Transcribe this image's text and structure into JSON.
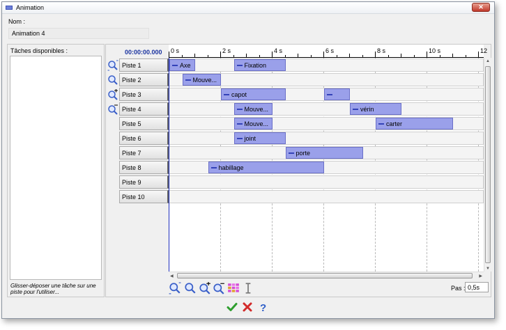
{
  "window": {
    "title": "Animation",
    "close_symbol": "✕"
  },
  "name_field": {
    "label": "Nom :",
    "value": "Animation 4"
  },
  "tasks": {
    "label": "Tâches disponibles :",
    "hint": "Glisser-déposer une tâche sur une piste pour l'utiliser..."
  },
  "timeline": {
    "time_readout": "00:00:00.000",
    "ruler_labels": [
      "0 s",
      "2 s",
      "4 s",
      "6 s",
      "8 s",
      "10 s",
      "12"
    ],
    "tracks": [
      {
        "label": "Piste 1",
        "segments": [
          {
            "text": "Axe",
            "start": 0,
            "end": 1
          },
          {
            "text": "Fixation",
            "start": 2.5,
            "end": 4.5
          }
        ]
      },
      {
        "label": "Piste 2",
        "segments": [
          {
            "text": "Mouve...",
            "start": 0.5,
            "end": 2
          }
        ]
      },
      {
        "label": "Piste 3",
        "segments": [
          {
            "text": "capot",
            "start": 2,
            "end": 4.5
          },
          {
            "text": "",
            "start": 6,
            "end": 7
          }
        ]
      },
      {
        "label": "Piste 4",
        "segments": [
          {
            "text": "Mouve...",
            "start": 2.5,
            "end": 4
          },
          {
            "text": "vérin",
            "start": 7,
            "end": 9
          }
        ]
      },
      {
        "label": "Piste 5",
        "segments": [
          {
            "text": "Mouve...",
            "start": 2.5,
            "end": 4
          },
          {
            "text": "carter",
            "start": 8,
            "end": 11
          }
        ]
      },
      {
        "label": "Piste 6",
        "segments": [
          {
            "text": "joint",
            "start": 2.5,
            "end": 4.5
          }
        ]
      },
      {
        "label": "Piste 7",
        "segments": [
          {
            "text": "porte",
            "start": 4.5,
            "end": 7.5
          }
        ]
      },
      {
        "label": "Piste 8",
        "segments": [
          {
            "text": "habillage",
            "start": 1.5,
            "end": 6
          }
        ]
      },
      {
        "label": "Piste 9",
        "segments": []
      },
      {
        "label": "Piste 10",
        "segments": []
      }
    ]
  },
  "step": {
    "label": "Pas :",
    "value": "0,5s"
  },
  "colors": {
    "segment": "#9aa0ea",
    "cursor": "#2030c0",
    "ok": "#2e9e2e",
    "cancel": "#d22a2a",
    "help": "#2f5fc8"
  }
}
